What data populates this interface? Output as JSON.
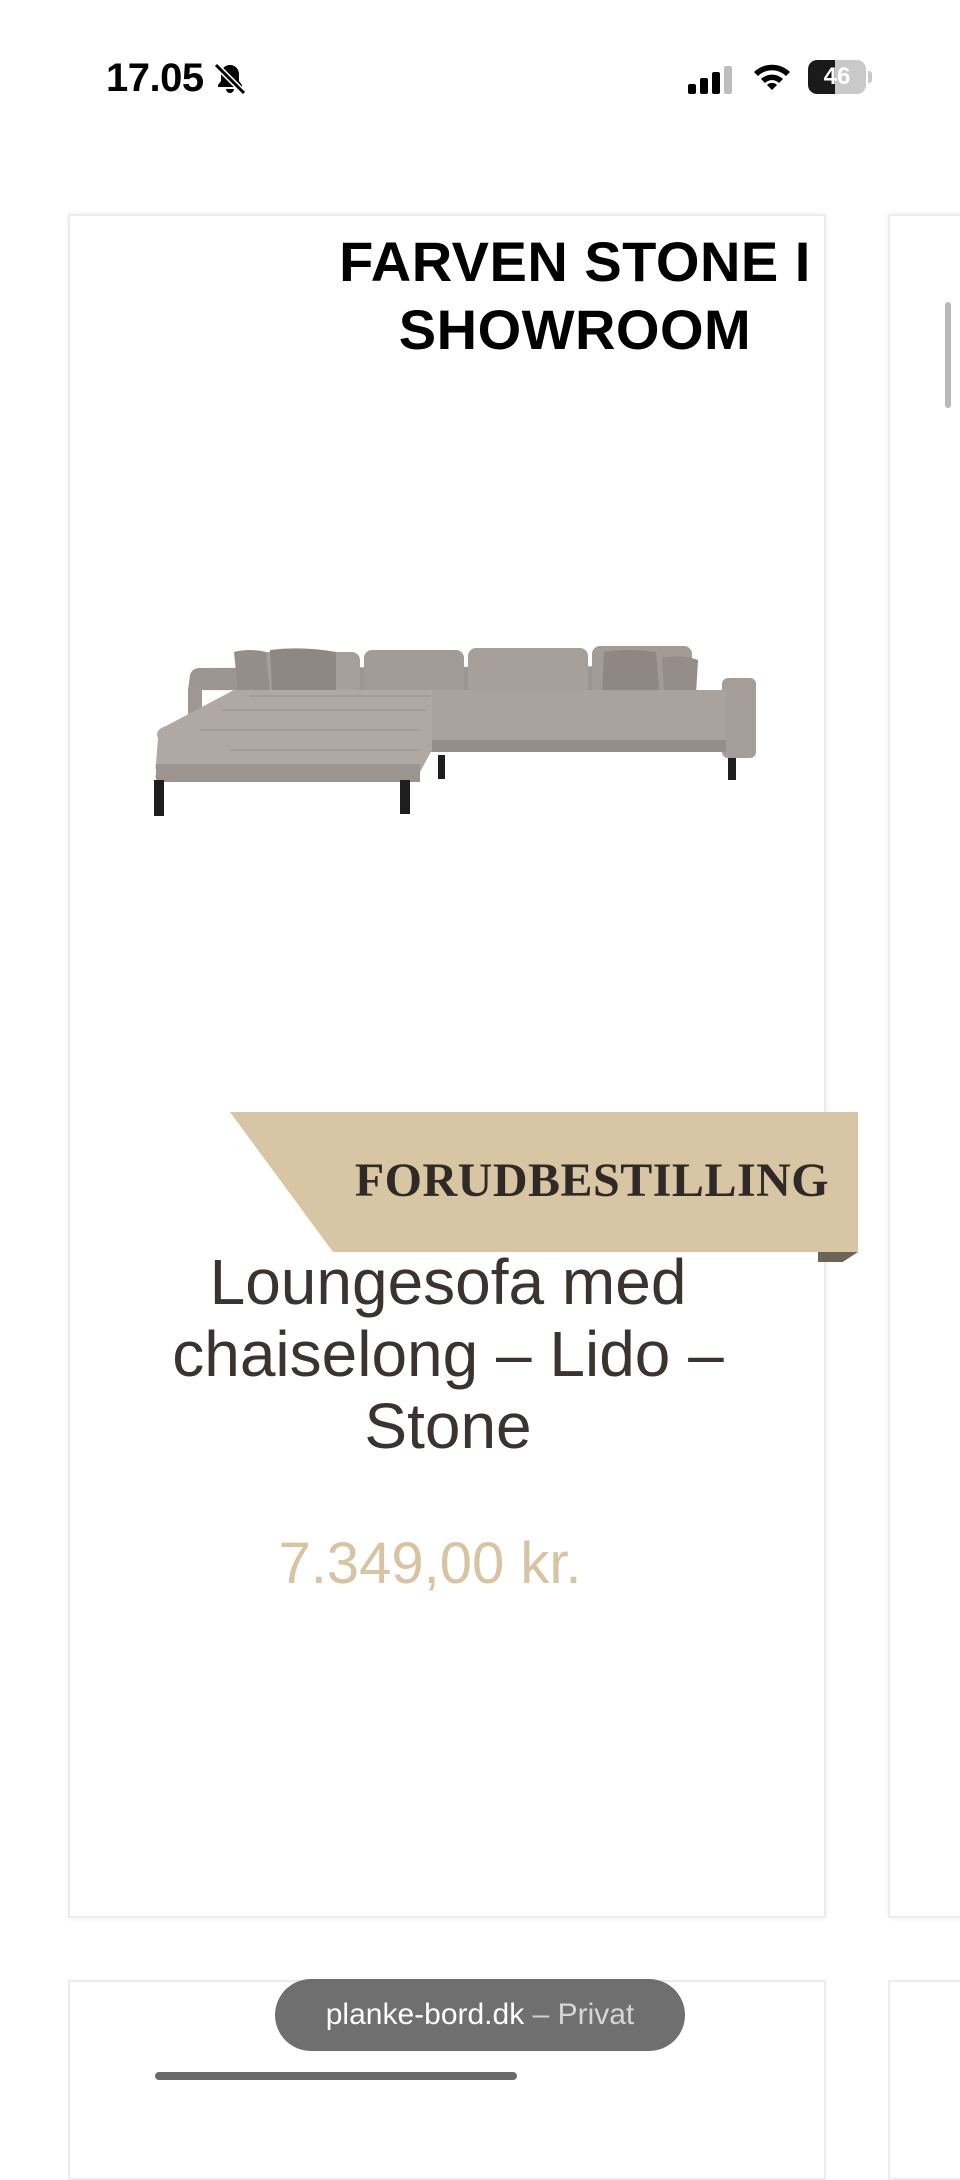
{
  "status_bar": {
    "time": "17.05",
    "battery_level": "46",
    "icons": [
      "bell-slash-icon",
      "signal-icon",
      "wifi-icon",
      "battery-icon"
    ]
  },
  "product": {
    "image_caption": "FARVEN STONE I SHOWROOM",
    "badge": "FORUDBESTILLING",
    "title": "Loungesofa med chaiselong – Lido – Stone",
    "price": "7.349,00 kr."
  },
  "browser": {
    "domain": "planke-bord.dk",
    "separator": " – ",
    "mode": "Privat"
  },
  "colors": {
    "badge_bg": "#d7c5a3",
    "badge_fold": "#6e6357",
    "price": "#d6c4a2",
    "title": "#3a332f",
    "sofa_fabric": "#a8a09a"
  }
}
